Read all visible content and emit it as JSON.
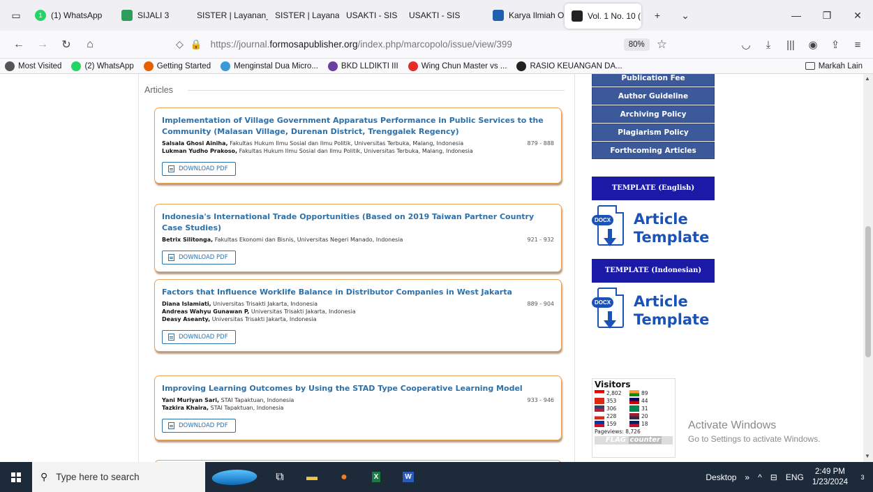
{
  "tabs": [
    {
      "label": "(1) WhatsApp",
      "icon": "whatsapp-icon",
      "color": "#25d366",
      "badge": "1"
    },
    {
      "label": "SIJALI 3",
      "icon": "sijali-icon",
      "color": "#2e9e5a"
    },
    {
      "label": "SISTER | Layanan_bkd",
      "icon": "",
      "color": ""
    },
    {
      "label": "SISTER | Layanan_bkd",
      "icon": "",
      "color": ""
    },
    {
      "label": "USAKTI - SIS",
      "icon": "",
      "color": ""
    },
    {
      "label": "USAKTI - SIS",
      "icon": "",
      "color": ""
    },
    {
      "label": "Karya Ilmiah Onli",
      "icon": "karya-icon",
      "color": "#1f5fb0"
    },
    {
      "label": "Vol. 1 No. 10 (",
      "icon": "pkp-icon",
      "color": "#222",
      "active": true
    }
  ],
  "nav": {
    "url_prefix": "https://journal.",
    "url_domain": "formosapublisher.org",
    "url_path": "/index.php/marcopolo/issue/view/399",
    "zoom": "80%"
  },
  "bookmarks": [
    {
      "label": "Most Visited",
      "icon": "gear-icon",
      "color": "#555"
    },
    {
      "label": "(2) WhatsApp",
      "icon": "whatsapp-icon",
      "color": "#25d366"
    },
    {
      "label": "Getting Started",
      "icon": "firefox-icon",
      "color": "#e66000"
    },
    {
      "label": "Menginstal Dua Micro...",
      "icon": "micro-icon",
      "color": "#3a9ad9"
    },
    {
      "label": "BKD LLDIKTI III",
      "icon": "bkd-icon",
      "color": "#6b3fa0"
    },
    {
      "label": "Wing Chun Master vs ...",
      "icon": "youtube-icon",
      "color": "#e52d27"
    },
    {
      "label": "RASIO KEUANGAN DA...",
      "icon": "pkp-icon",
      "color": "#222"
    }
  ],
  "bookmarks_folder": "Markah Lain",
  "section_title": "Articles",
  "articles": [
    {
      "title": "Implementation of Village Government Apparatus Performance in Public Services to the Community (Malasan Village, Durenan District, Trenggalek Regency)",
      "pages": "879 - 888",
      "authors": [
        {
          "name": "Salsala Ghosi Ainiha,",
          "affil": "Fakultas Hukum Ilmu Sosial dan Ilmu Politik, Universitas Terbuka, Malang,  Indonesia"
        },
        {
          "name": "Lukman Yudho Prakoso,",
          "affil": "Fakultas Hukum Ilmu Sosial dan Ilmu Politik, Universitas Terbuka, Malang,  Indonesia"
        }
      ],
      "download": "DOWNLOAD PDF"
    },
    {
      "title": "Indonesia's International Trade Opportunities (Based on 2019 Taiwan Partner Country Case Studies)",
      "pages": "921 - 932",
      "authors": [
        {
          "name": "Betrix Silitonga,",
          "affil": "Fakultas Ekonomi dan Bisnis, Universitas Negeri Manado,  Indonesia"
        }
      ],
      "download": "DOWNLOAD PDF"
    },
    {
      "title": "Factors that Influence Worklife Balance in Distributor Companies in West Jakarta",
      "pages": "889 - 904",
      "authors": [
        {
          "name": "Diana Islamiati,",
          "affil": "Universitas Trisakti Jakarta,  Indonesia"
        },
        {
          "name": "Andreas Wahyu Gunawan P,",
          "affil": "Universitas Trisakti Jakarta,  Indonesia"
        },
        {
          "name": "Deasy Aseanty,",
          "affil": "Universitas Trisakti Jakarta,  Indonesia"
        }
      ],
      "download": "DOWNLOAD PDF"
    },
    {
      "title": "Improving Learning Outcomes by Using the STAD Type Cooperative Learning Model",
      "pages": "933 - 946",
      "authors": [
        {
          "name": "Yani Muriyan Sari,",
          "affil": "STAI Tapaktuan,  Indonesia"
        },
        {
          "name": "Tazkira Khaira,",
          "affil": "STAI Tapaktuan,  Indonesia"
        }
      ],
      "download": "DOWNLOAD PDF"
    }
  ],
  "sidebar": {
    "links": [
      "Publication Fee",
      "Author Guideline",
      "Archiving Policy",
      "Plagiarism Policy",
      "Forthcoming Articles"
    ],
    "template_en": "TEMPLATE (English)",
    "template_id": "TEMPLATE (Indonesian)",
    "docx_label": "DOCX",
    "tpl_line1": "Article",
    "tpl_line2": "Template"
  },
  "visitors": {
    "title": "Visitors",
    "left": [
      {
        "count": "2,802",
        "flag": "id-flag"
      },
      {
        "count": "353",
        "flag": "cn-flag"
      },
      {
        "count": "306",
        "flag": "us-flag"
      },
      {
        "count": "228",
        "flag": "ru-flag"
      },
      {
        "count": "159",
        "flag": "ph-flag"
      }
    ],
    "right": [
      {
        "count": "89",
        "flag": "in-flag"
      },
      {
        "count": "44",
        "flag": "my-flag"
      },
      {
        "count": "31",
        "flag": "ng-flag"
      },
      {
        "count": "20",
        "flag": "th-flag"
      },
      {
        "count": "18",
        "flag": "gb-flag"
      }
    ],
    "pageviews": "Pageviews: 8,726",
    "brand_a": "FLAG",
    "brand_b": "counter"
  },
  "activate": {
    "line1": "Activate Windows",
    "line2": "Go to Settings to activate Windows."
  },
  "taskbar": {
    "search_placeholder": "Type here to search",
    "desktop": "Desktop",
    "lang": "ENG",
    "time": "2:49 PM",
    "date": "1/23/2024",
    "notif_count": "3"
  }
}
